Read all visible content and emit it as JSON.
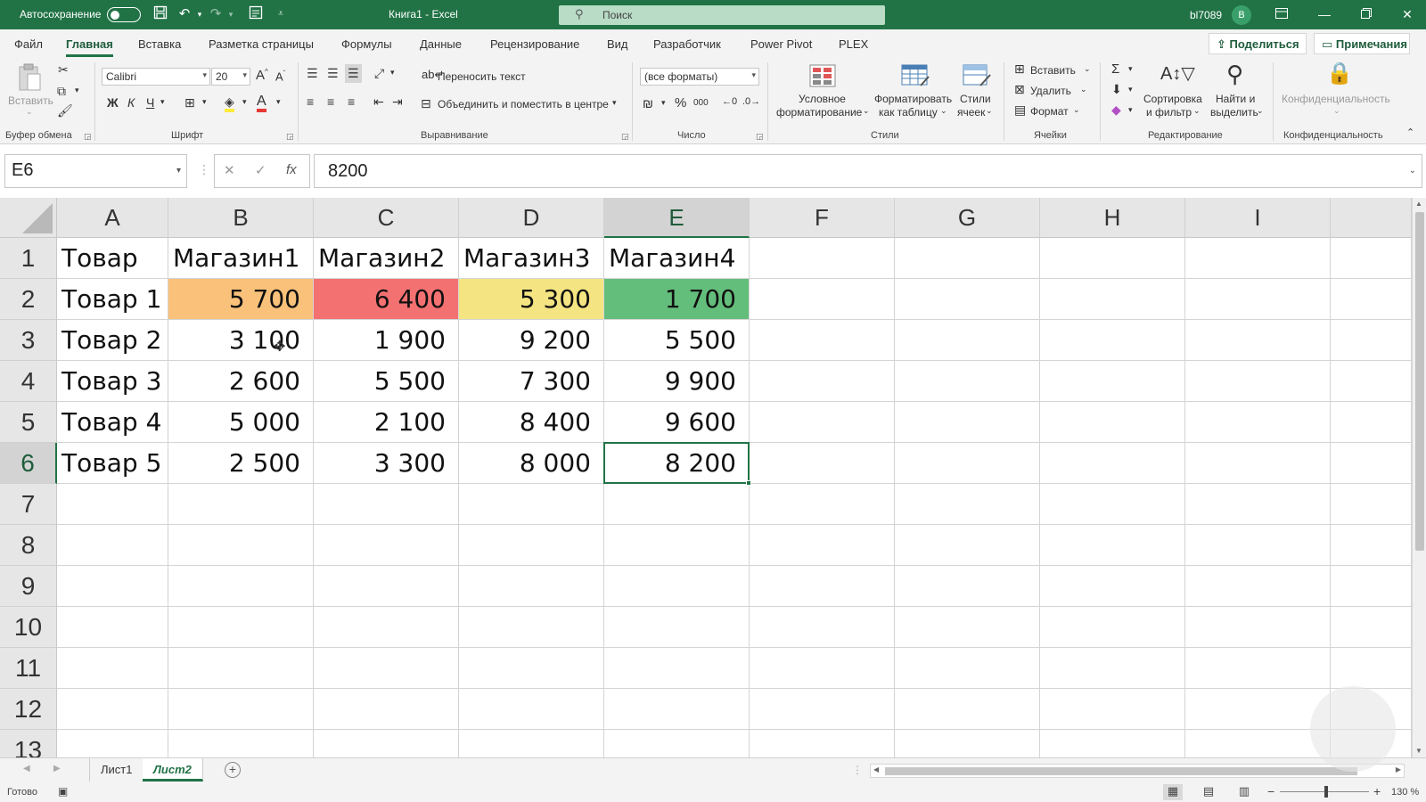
{
  "titlebar": {
    "autosave_label": "Автосохранение",
    "doc_title": "Книга1 - Excel",
    "search_placeholder": "Поиск",
    "user": "bl7089",
    "avatar_letter": "B"
  },
  "menu": {
    "tabs": [
      "Файл",
      "Главная",
      "Вставка",
      "Разметка страницы",
      "Формулы",
      "Данные",
      "Рецензирование",
      "Вид",
      "Разработчик",
      "Power Pivot",
      "PLEX"
    ],
    "active": "Главная",
    "share": "Поделиться",
    "notes": "Примечания"
  },
  "ribbon": {
    "clipboard": {
      "paste": "Вставить",
      "label": "Буфер обмена"
    },
    "font": {
      "name": "Calibri",
      "size": "20",
      "bold": "Ж",
      "italic": "К",
      "underline": "Ч",
      "label": "Шрифт"
    },
    "alignment": {
      "wrap": "Переносить текст",
      "merge": "Объединить и поместить в центре",
      "label": "Выравнивание"
    },
    "number": {
      "format": "(все форматы)",
      "label": "Число"
    },
    "styles": {
      "conditional_1": "Условное",
      "conditional_2": "форматирование",
      "table_1": "Форматировать",
      "table_2": "как таблицу",
      "cellstyles_1": "Стили",
      "cellstyles_2": "ячеек",
      "label": "Стили"
    },
    "cells": {
      "insert": "Вставить",
      "delete": "Удалить",
      "format": "Формат",
      "label": "Ячейки"
    },
    "editing": {
      "sort_1": "Сортировка",
      "sort_2": "и фильтр",
      "find_1": "Найти и",
      "find_2": "выделить",
      "label": "Редактирование"
    },
    "privacy": {
      "button": "Конфиденциальность",
      "label": "Конфиденциальность"
    }
  },
  "formula": {
    "namebox": "E6",
    "value": "8200"
  },
  "grid": {
    "columns": [
      "A",
      "B",
      "C",
      "D",
      "E",
      "F",
      "G",
      "H",
      "I"
    ],
    "rows": [
      "1",
      "2",
      "3",
      "4",
      "5",
      "6",
      "7",
      "8",
      "9",
      "10",
      "11",
      "12",
      "13"
    ],
    "selected_cell": "E6",
    "data": [
      [
        "Товар",
        "Магазин1",
        "Магазин2",
        "Магазин3",
        "Магазин4"
      ],
      [
        "Товар 1",
        "5 700",
        "6 400",
        "5 300",
        "1 700"
      ],
      [
        "Товар 2",
        "3 100",
        "1 900",
        "9 200",
        "5 500"
      ],
      [
        "Товар 3",
        "2 600",
        "5 500",
        "7 300",
        "9 900"
      ],
      [
        "Товар 4",
        "5 000",
        "2 100",
        "8 400",
        "9 600"
      ],
      [
        "Товар 5",
        "2 500",
        "3 300",
        "8 000",
        "8 200"
      ]
    ],
    "highlight_colors": {
      "B2": "#f9c17a",
      "C2": "#f47171",
      "D2": "#f5e582",
      "E2": "#63be7b"
    }
  },
  "sheets": {
    "tabs": [
      "Лист1",
      "Лист2"
    ],
    "active": "Лист2"
  },
  "status": {
    "ready": "Готово",
    "zoom": "130 %"
  },
  "colors": {
    "accent": "#217346"
  }
}
